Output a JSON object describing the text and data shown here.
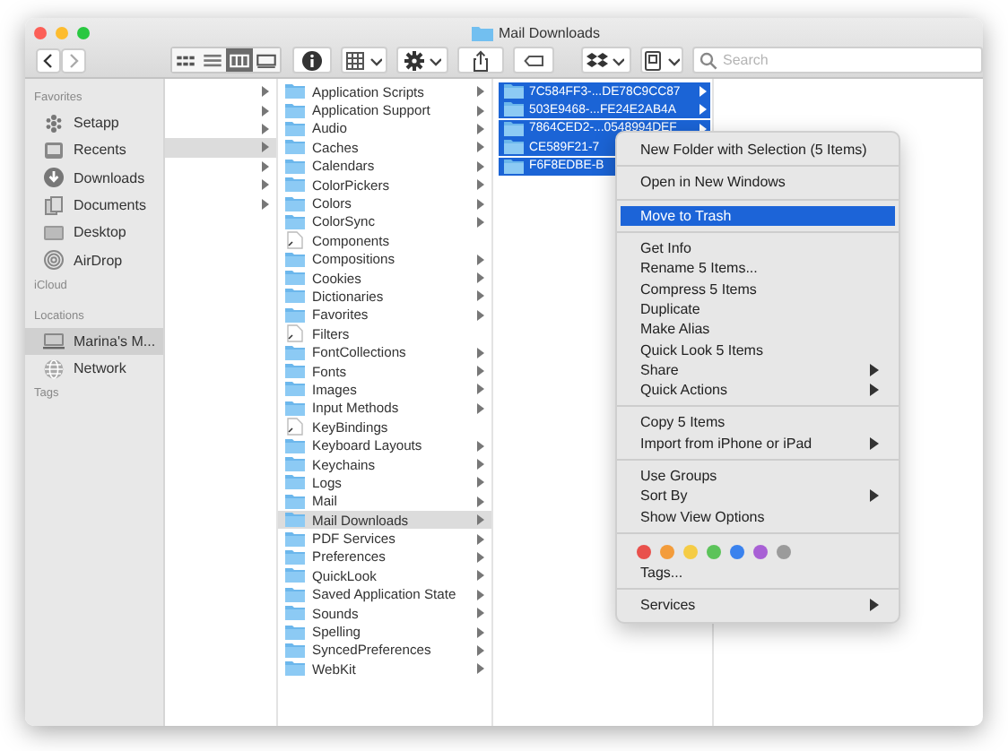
{
  "window": {
    "title": "Mail Downloads"
  },
  "toolbar": {
    "view_modes": [
      {
        "kind": "icons",
        "selected": false
      },
      {
        "kind": "list",
        "selected": false
      },
      {
        "kind": "columns",
        "selected": true
      },
      {
        "kind": "gallery",
        "selected": false
      }
    ],
    "search": {
      "placeholder": "Search"
    }
  },
  "sidebar": {
    "sections": [
      {
        "heading": "Favorites",
        "items": [
          {
            "label": "Setapp",
            "kind": "setapp",
            "selected": false
          },
          {
            "label": "Recents",
            "kind": "recents",
            "selected": false
          },
          {
            "label": "Downloads",
            "kind": "downloads",
            "selected": false
          },
          {
            "label": "Documents",
            "kind": "documents",
            "selected": false
          },
          {
            "label": "Desktop",
            "kind": "desktop",
            "selected": false
          },
          {
            "label": "AirDrop",
            "kind": "airdrop",
            "selected": false
          }
        ]
      },
      {
        "heading": "iCloud"
      },
      {
        "heading": "Locations",
        "items": [
          {
            "label": "Marina's M...",
            "kind": "computer",
            "selected": true
          },
          {
            "label": "Network",
            "kind": "network",
            "selected": false
          }
        ]
      },
      {
        "heading": "Tags"
      }
    ]
  },
  "columns": [
    {
      "rows": [
        {
          "has_children": true,
          "selected": false
        },
        {
          "has_children": true,
          "selected": false
        },
        {
          "has_children": true,
          "selected": false
        },
        {
          "has_children": true,
          "selected": true
        },
        {
          "has_children": true,
          "selected": false
        },
        {
          "has_children": true,
          "selected": false
        },
        {
          "has_children": true,
          "selected": false
        }
      ]
    },
    {
      "rows": [
        {
          "name": "Application Scripts",
          "kind": "folder",
          "has_children": true,
          "selected": false
        },
        {
          "name": "Application Support",
          "kind": "folder",
          "has_children": true,
          "selected": false
        },
        {
          "name": "Audio",
          "kind": "folder",
          "has_children": true,
          "selected": false
        },
        {
          "name": "Caches",
          "kind": "folder",
          "has_children": true,
          "selected": false
        },
        {
          "name": "Calendars",
          "kind": "folder",
          "has_children": true,
          "selected": false
        },
        {
          "name": "ColorPickers",
          "kind": "folder",
          "has_children": true,
          "selected": false
        },
        {
          "name": "Colors",
          "kind": "folder",
          "has_children": true,
          "selected": false
        },
        {
          "name": "ColorSync",
          "kind": "folder",
          "has_children": true,
          "selected": false
        },
        {
          "name": "Components",
          "kind": "file",
          "has_children": false,
          "selected": false
        },
        {
          "name": "Compositions",
          "kind": "folder",
          "has_children": true,
          "selected": false
        },
        {
          "name": "Cookies",
          "kind": "folder",
          "has_children": true,
          "selected": false
        },
        {
          "name": "Dictionaries",
          "kind": "folder",
          "has_children": true,
          "selected": false
        },
        {
          "name": "Favorites",
          "kind": "folder",
          "has_children": true,
          "selected": false
        },
        {
          "name": "Filters",
          "kind": "file",
          "has_children": false,
          "selected": false
        },
        {
          "name": "FontCollections",
          "kind": "folder",
          "has_children": true,
          "selected": false
        },
        {
          "name": "Fonts",
          "kind": "folder",
          "has_children": true,
          "selected": false
        },
        {
          "name": "Images",
          "kind": "folder",
          "has_children": true,
          "selected": false
        },
        {
          "name": "Input Methods",
          "kind": "folder",
          "has_children": true,
          "selected": false
        },
        {
          "name": "KeyBindings",
          "kind": "file",
          "has_children": false,
          "selected": false
        },
        {
          "name": "Keyboard Layouts",
          "kind": "folder",
          "has_children": true,
          "selected": false
        },
        {
          "name": "Keychains",
          "kind": "folder",
          "has_children": true,
          "selected": false
        },
        {
          "name": "Logs",
          "kind": "folder",
          "has_children": true,
          "selected": false
        },
        {
          "name": "Mail",
          "kind": "folder",
          "has_children": true,
          "selected": false
        },
        {
          "name": "Mail Downloads",
          "kind": "folder",
          "has_children": true,
          "selected": true
        },
        {
          "name": "PDF Services",
          "kind": "folder",
          "has_children": true,
          "selected": false
        },
        {
          "name": "Preferences",
          "kind": "folder",
          "has_children": true,
          "selected": false
        },
        {
          "name": "QuickLook",
          "kind": "folder",
          "has_children": true,
          "selected": false
        },
        {
          "name": "Saved Application State",
          "kind": "folder",
          "has_children": true,
          "selected": false
        },
        {
          "name": "Sounds",
          "kind": "folder",
          "has_children": true,
          "selected": false
        },
        {
          "name": "Spelling",
          "kind": "folder",
          "has_children": true,
          "selected": false
        },
        {
          "name": "SyncedPreferences",
          "kind": "folder",
          "has_children": true,
          "selected": false
        },
        {
          "name": "WebKit",
          "kind": "folder",
          "has_children": true,
          "selected": false
        }
      ]
    },
    {
      "rows": [
        {
          "name": "7C584FF3-...DE78C9CC87",
          "kind": "folder",
          "has_children": true,
          "selected": true
        },
        {
          "name": "503E9468-...FE24E2AB4A",
          "kind": "folder",
          "has_children": true,
          "selected": true
        },
        {
          "name": "7864CED2-...0548994DEF",
          "kind": "folder",
          "has_children": true,
          "selected": true
        },
        {
          "name": "CE589F21-7",
          "kind": "folder",
          "selected": true
        },
        {
          "name": "F6F8EDBE-B",
          "kind": "folder",
          "selected": true
        }
      ]
    }
  ],
  "context_menu": {
    "groups": [
      {
        "items": [
          {
            "kind": "item",
            "label": "New Folder with Selection (5 Items)",
            "highlighted": false,
            "submenu": false
          }
        ]
      },
      {
        "items": [
          {
            "kind": "item",
            "label": "Open in New Windows",
            "highlighted": false,
            "submenu": false
          }
        ]
      },
      {
        "items": [
          {
            "kind": "item",
            "label": "Move to Trash",
            "highlighted": true,
            "submenu": false
          }
        ]
      },
      {
        "items": [
          {
            "kind": "item",
            "label": "Get Info",
            "highlighted": false,
            "submenu": false
          },
          {
            "kind": "item",
            "label": "Rename 5 Items...",
            "highlighted": false,
            "submenu": false
          },
          {
            "kind": "item",
            "label": "Compress 5 Items",
            "highlighted": false,
            "submenu": false
          },
          {
            "kind": "item",
            "label": "Duplicate",
            "highlighted": false,
            "submenu": false
          },
          {
            "kind": "item",
            "label": "Make Alias",
            "highlighted": false,
            "submenu": false
          },
          {
            "kind": "item",
            "label": "Quick Look 5 Items",
            "highlighted": false,
            "submenu": false
          },
          {
            "kind": "item",
            "label": "Share",
            "highlighted": false,
            "submenu": true
          },
          {
            "kind": "item",
            "label": "Quick Actions",
            "highlighted": false,
            "submenu": true
          }
        ]
      },
      {
        "items": [
          {
            "kind": "item",
            "label": "Copy 5 Items",
            "highlighted": false,
            "submenu": false
          },
          {
            "kind": "item",
            "label": "Import from iPhone or iPad",
            "highlighted": false,
            "submenu": true
          }
        ]
      },
      {
        "items": [
          {
            "kind": "item",
            "label": "Use Groups",
            "highlighted": false,
            "submenu": false
          },
          {
            "kind": "item",
            "label": "Sort By",
            "highlighted": false,
            "submenu": true
          },
          {
            "kind": "item",
            "label": "Show View Options",
            "highlighted": false,
            "submenu": false
          }
        ]
      },
      {
        "items": [
          {
            "kind": "colors",
            "colors": [
              {
                "color": "#e9514c"
              },
              {
                "color": "#f39c3b"
              },
              {
                "color": "#f5cc45"
              },
              {
                "color": "#5cc35a"
              },
              {
                "color": "#3a82ee"
              },
              {
                "color": "#a860d5"
              },
              {
                "color": "#9b9b9b"
              }
            ]
          },
          {
            "kind": "item",
            "label": "Tags...",
            "highlighted": false,
            "submenu": false
          }
        ]
      },
      {
        "items": [
          {
            "kind": "item",
            "label": "Services",
            "highlighted": false,
            "submenu": true
          }
        ]
      }
    ]
  }
}
